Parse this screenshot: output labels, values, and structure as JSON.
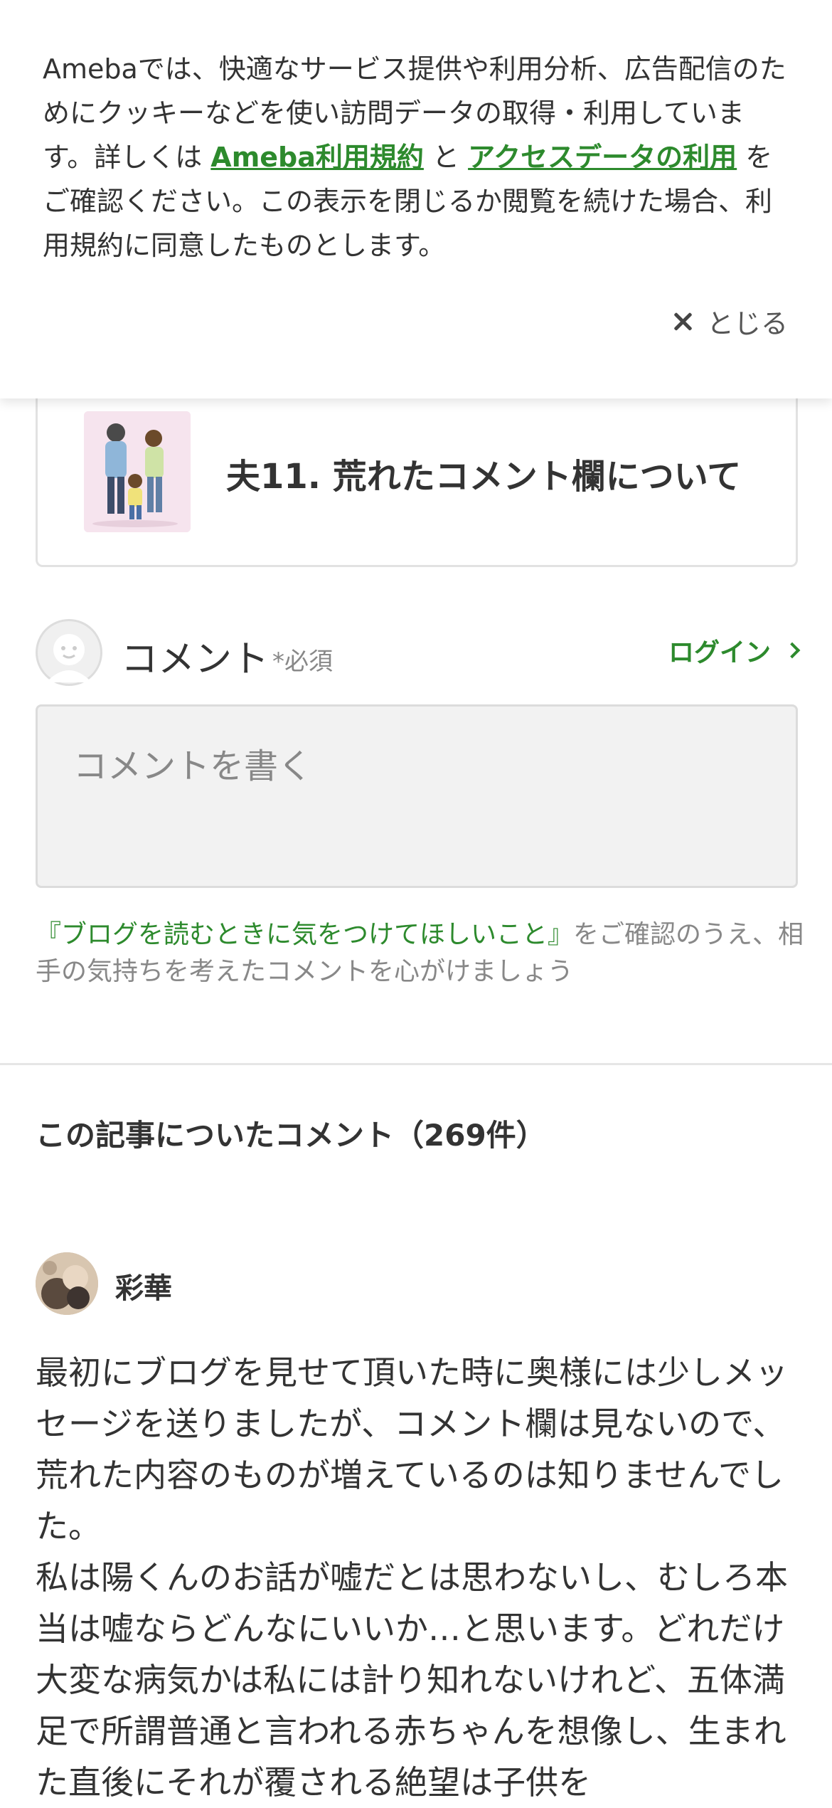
{
  "cookie_banner": {
    "text_before": "Amebaでは、快適なサービス提供や利用分析、広告配信のためにクッキーなどを使い訪問データの取得・利用しています。詳しくは ",
    "link_terms": "Ameba利用規約",
    "text_and": " と ",
    "link_access": "アクセスデータの利用",
    "text_after": " をご確認ください。この表示を閉じるか閲覧を続けた場合、利用規約に同意したものとします。",
    "close_label": "とじる"
  },
  "article": {
    "title": "夫11. 荒れたコメント欄について"
  },
  "comment_form": {
    "label": "コメント",
    "required": "*必須",
    "login_label": "ログイン",
    "placeholder": "コメントを書く",
    "guideline_link": "『ブログを読むときに気をつけてほしいこと』",
    "guideline_text": "をご確認のうえ、相手の気持ちを考えたコメントを心がけましょう"
  },
  "comments": {
    "heading": "この記事についたコメント（269件）",
    "items": [
      {
        "author": "彩華",
        "paragraphs": [
          "最初にブログを見せて頂いた時に奥様には少しメッセージを送りましたが、コメント欄は見ないので、荒れた内容のものが増えているのは知りませんでした。",
          "私は陽くんのお話が嘘だとは思わないし、むしろ本当は嘘ならどんなにいいか…と思います。どれだけ大変な病気かは私には計り知れないけれど、五体満足で所謂普通と言われる赤ちゃんを想像し、生まれた直後にそれが覆される絶望は子供を"
        ]
      }
    ]
  },
  "colors": {
    "accent_green": "#2d8a2d",
    "text": "#333333",
    "muted": "#888888"
  }
}
